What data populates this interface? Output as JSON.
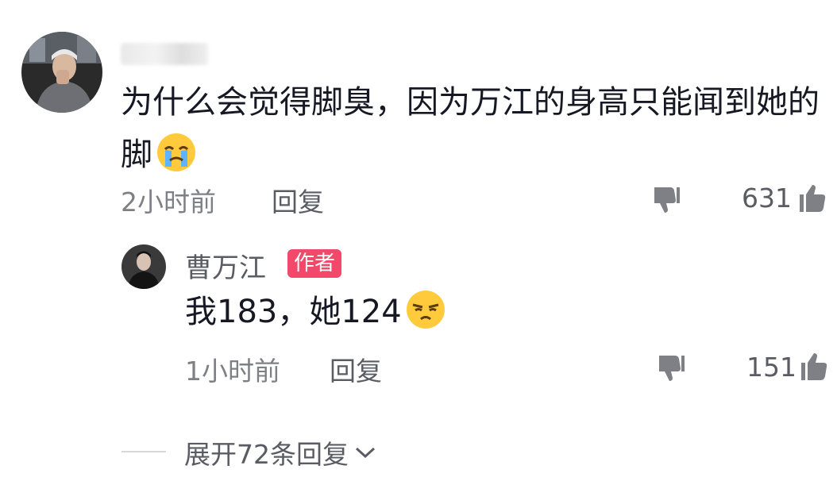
{
  "comment": {
    "username": "",
    "text": "为什么会觉得脚臭，因为万江的身高只能闻到她的脚",
    "emoji": "crying-face-emoji",
    "time": "2小时前",
    "reply_label": "回复",
    "like_count": "631"
  },
  "reply": {
    "username": "曹万江",
    "badge": "作者",
    "text": "我183，她124",
    "emoji": "smug-face-emoji",
    "time": "1小时前",
    "reply_label": "回复",
    "like_count": "151"
  },
  "expand": {
    "label": "展开72条回复"
  },
  "colors": {
    "badge": "#f2486a",
    "text_primary": "#161823",
    "text_secondary": "#7f8086",
    "icon": "#7f8086"
  }
}
